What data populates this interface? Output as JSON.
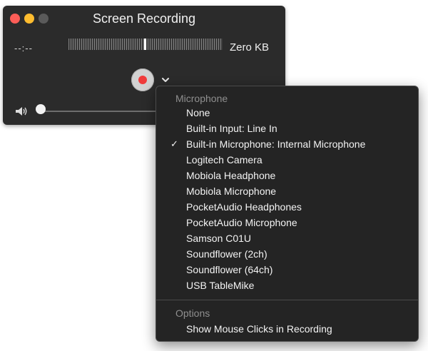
{
  "window": {
    "title": "Screen Recording",
    "time_display": "--:--",
    "file_size": "Zero KB",
    "colors": {
      "close": "#fc5d57",
      "minimize": "#fdbc2f",
      "zoom": "#5a5a5a",
      "record": "#f03b3b"
    },
    "volume_level": 0.0
  },
  "menu": {
    "microphone_header": "Microphone",
    "items": [
      {
        "label": "None",
        "checked": false
      },
      {
        "label": "Built-in Input: Line In",
        "checked": false
      },
      {
        "label": "Built-in Microphone: Internal Microphone",
        "checked": true,
        "check_mark": "✓"
      },
      {
        "label": "Logitech Camera",
        "checked": false
      },
      {
        "label": "Mobiola Headphone",
        "checked": false
      },
      {
        "label": "Mobiola Microphone",
        "checked": false
      },
      {
        "label": "PocketAudio Headphones",
        "checked": false
      },
      {
        "label": "PocketAudio Microphone",
        "checked": false
      },
      {
        "label": "Samson C01U",
        "checked": false
      },
      {
        "label": "Soundflower (2ch)",
        "checked": false
      },
      {
        "label": "Soundflower (64ch)",
        "checked": false
      },
      {
        "label": "USB TableMike",
        "checked": false
      }
    ],
    "options_header": "Options",
    "options_items": [
      {
        "label": "Show Mouse Clicks in Recording"
      }
    ]
  }
}
